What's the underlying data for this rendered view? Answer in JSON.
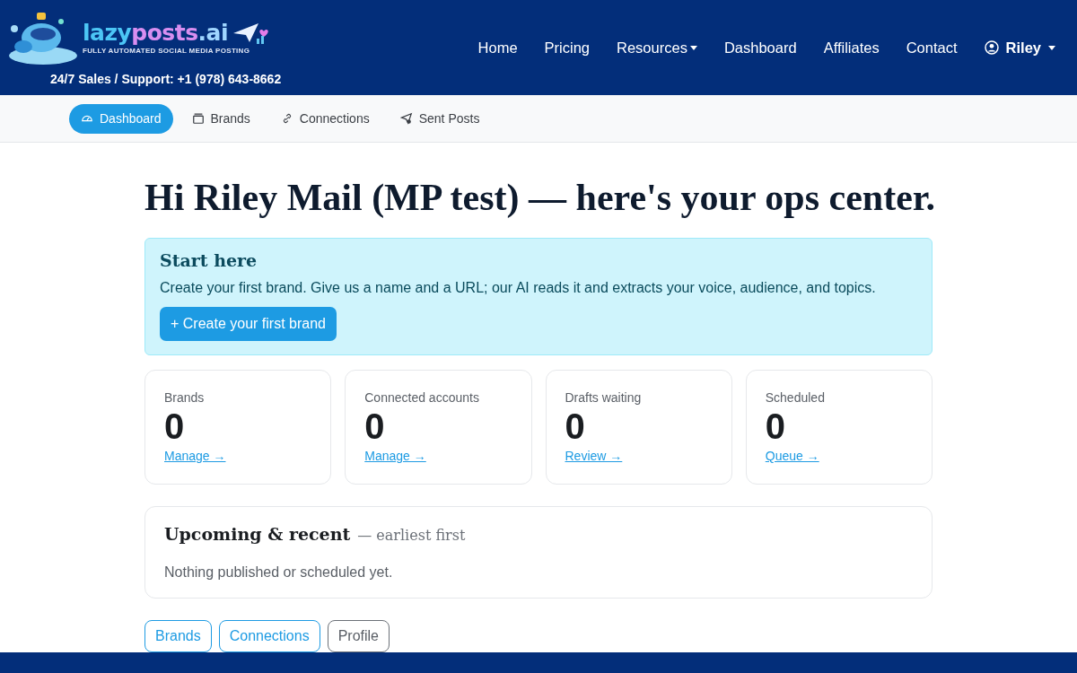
{
  "brand": {
    "name_start": "lazy",
    "name_mid": "posts",
    "name_end": ".ai",
    "tagline": "FULLY AUTOMATED SOCIAL MEDIA POSTING",
    "support": "24/7 Sales / Support: +1 (978) 643-8662"
  },
  "nav": [
    {
      "label": "Home",
      "kind": "link"
    },
    {
      "label": "Pricing",
      "kind": "link"
    },
    {
      "label": "Resources",
      "kind": "dropdown"
    },
    {
      "label": "Dashboard",
      "kind": "link"
    },
    {
      "label": "Affiliates",
      "kind": "link"
    },
    {
      "label": "Contact",
      "kind": "link"
    },
    {
      "label": "Riley",
      "kind": "user"
    }
  ],
  "subnav": [
    {
      "label": "Dashboard",
      "selected": true
    },
    {
      "label": "Brands",
      "selected": false
    },
    {
      "label": "Connections",
      "selected": false
    },
    {
      "label": "Sent Posts",
      "selected": false
    }
  ],
  "heading": "Hi Riley Mail (MP test) — here's your ops center.",
  "start": {
    "title": "Start here",
    "text": "Create your first brand. Give us a name and a URL; our AI reads it and extracts your voice, audience, and topics.",
    "button": "+ Create your first brand"
  },
  "stats": [
    {
      "label": "Brands",
      "value": "0",
      "link": "Manage →"
    },
    {
      "label": "Connected accounts",
      "value": "0",
      "link": "Manage →"
    },
    {
      "label": "Drafts waiting",
      "value": "0",
      "link": "Review →"
    },
    {
      "label": "Scheduled",
      "value": "0",
      "link": "Queue →"
    }
  ],
  "recent": {
    "title": "Upcoming & recent",
    "subtitle": "— earliest first",
    "empty": "Nothing published or scheduled yet."
  },
  "buttons": [
    {
      "label": "Brands",
      "kind": "primary"
    },
    {
      "label": "Connections",
      "kind": "primary"
    },
    {
      "label": "Profile",
      "kind": "secondary"
    }
  ]
}
